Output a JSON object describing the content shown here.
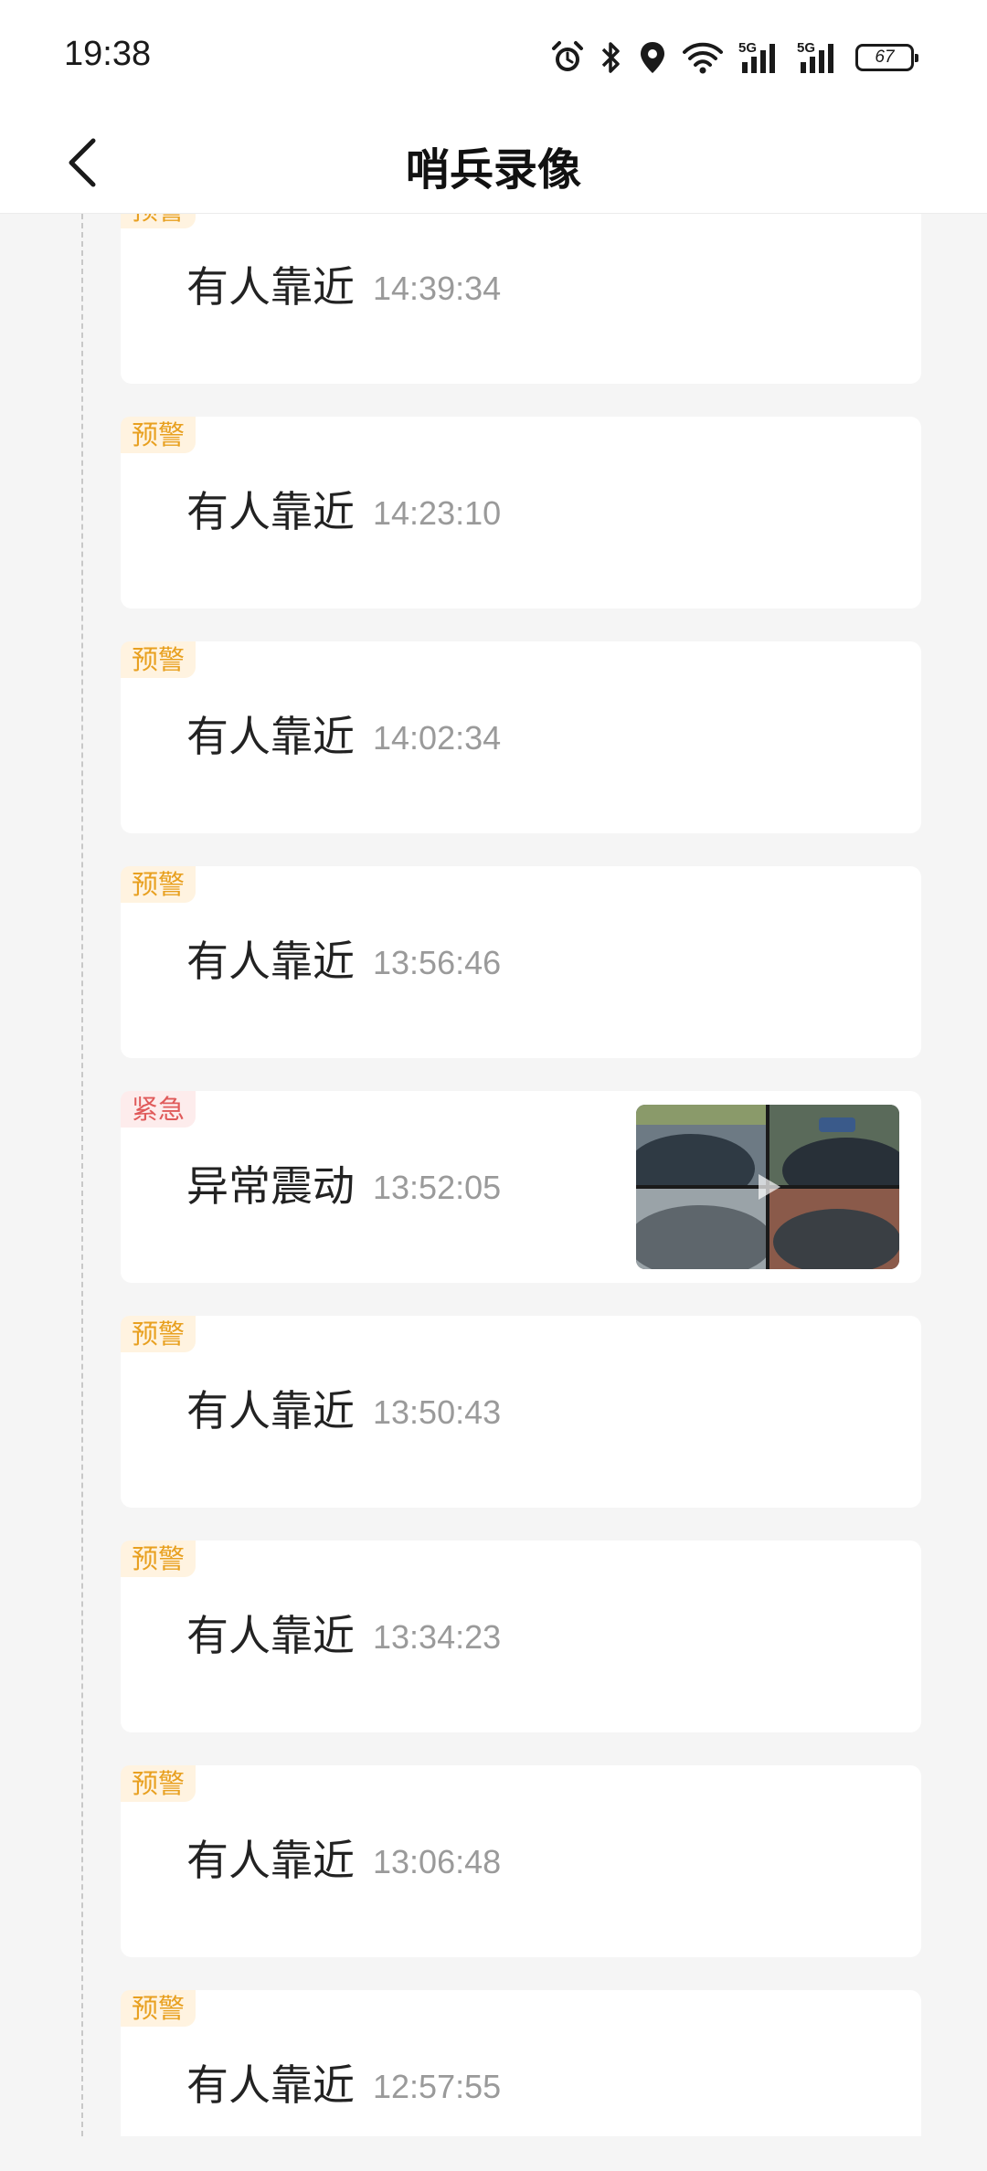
{
  "status_bar": {
    "time": "19:38",
    "battery": "67",
    "network_1": "5G",
    "network_2": "5G",
    "icons": [
      "alarm-icon",
      "bluetooth-icon",
      "location-icon",
      "wifi-icon",
      "signal-icon",
      "signal-icon",
      "battery-icon"
    ]
  },
  "header": {
    "title": "哨兵录像",
    "back_icon": "chevron-left-icon"
  },
  "colors": {
    "warn_tag_bg": "#fff3e0",
    "warn_tag_text": "#e8a020",
    "urgent_tag_bg": "#fdecec",
    "urgent_tag_text": "#e05a5a",
    "time_text": "#9a9a9a"
  },
  "events": [
    {
      "tag": "预警",
      "level": "warn",
      "title": "有人靠近",
      "time": "14:39:34",
      "has_thumbnail": false
    },
    {
      "tag": "预警",
      "level": "warn",
      "title": "有人靠近",
      "time": "14:23:10",
      "has_thumbnail": false
    },
    {
      "tag": "预警",
      "level": "warn",
      "title": "有人靠近",
      "time": "14:02:34",
      "has_thumbnail": false
    },
    {
      "tag": "预警",
      "level": "warn",
      "title": "有人靠近",
      "time": "13:56:46",
      "has_thumbnail": false
    },
    {
      "tag": "紧急",
      "level": "urgent",
      "title": "异常震动",
      "time": "13:52:05",
      "has_thumbnail": true
    },
    {
      "tag": "预警",
      "level": "warn",
      "title": "有人靠近",
      "time": "13:50:43",
      "has_thumbnail": false
    },
    {
      "tag": "预警",
      "level": "warn",
      "title": "有人靠近",
      "time": "13:34:23",
      "has_thumbnail": false
    },
    {
      "tag": "预警",
      "level": "warn",
      "title": "有人靠近",
      "time": "13:06:48",
      "has_thumbnail": false
    },
    {
      "tag": "预警",
      "level": "warn",
      "title": "有人靠近",
      "time": "12:57:55",
      "has_thumbnail": false
    }
  ]
}
